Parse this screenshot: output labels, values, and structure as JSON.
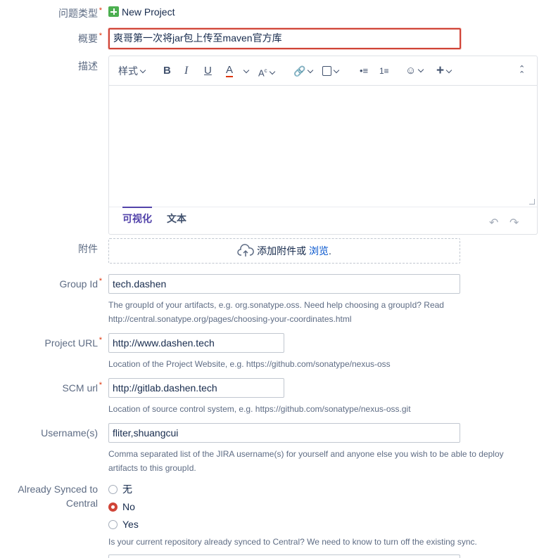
{
  "issue_type": {
    "label": "问题类型",
    "value": "New Project"
  },
  "summary": {
    "label": "概要",
    "value": "爽哥第一次将jar包上传至maven官方库"
  },
  "description": {
    "label": "描述",
    "toolbar": {
      "style_label": "样式"
    },
    "mode_tabs": [
      {
        "label": "可视化",
        "active": true
      },
      {
        "label": "文本",
        "active": false
      }
    ]
  },
  "attachment": {
    "label": "附件",
    "drop_text": "添加附件或",
    "browse_link": "浏览",
    "suffix": "."
  },
  "group_id": {
    "label": "Group Id",
    "value": "tech.dashen",
    "help_line1": "The groupId of your artifacts, e.g. org.sonatype.oss. Need help choosing a groupId? Read",
    "help_line2": "http://central.sonatype.org/pages/choosing-your-coordinates.html"
  },
  "project_url": {
    "label": "Project URL",
    "value": "http://www.dashen.tech",
    "help": "Location of the Project Website, e.g. https://github.com/sonatype/nexus-oss"
  },
  "scm_url": {
    "label": "SCM url",
    "value": "http://gitlab.dashen.tech",
    "help": "Location of source control system, e.g. https://github.com/sonatype/nexus-oss.git"
  },
  "usernames": {
    "label": "Username(s)",
    "value": "fliter,shuangcui",
    "help_line1": "Comma separated list of the JIRA username(s) for yourself and anyone else you wish to be able to deploy",
    "help_line2": "artifacts to this groupId."
  },
  "synced": {
    "label_line1": "Already Synced to",
    "label_line2": "Central",
    "options": [
      {
        "label": "无",
        "checked": false
      },
      {
        "label": "No",
        "checked": true
      },
      {
        "label": "Yes",
        "checked": false
      }
    ],
    "help": "Is your current repository already synced to Central? We need to know to turn off the existing sync."
  },
  "colors": {
    "required": "#de350b",
    "error_border": "#d04437",
    "link": "#0052cc",
    "active_tab": "#5243aa"
  }
}
